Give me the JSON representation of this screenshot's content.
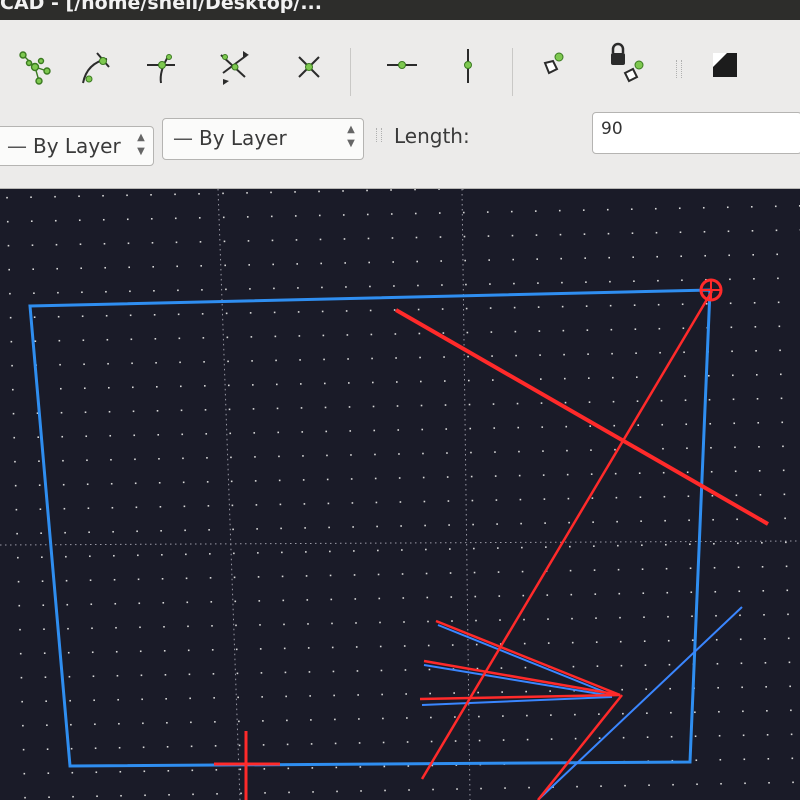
{
  "window": {
    "title": "CAD - [/home/shell/Desktop/..."
  },
  "toolbar": {
    "tools": [
      "snap-free-icon",
      "snap-on-entity-icon",
      "snap-center-icon",
      "snap-intersection-icon",
      "snap-crosshair-icon",
      "restrict-horizontal-icon",
      "restrict-vertical-icon",
      "relative-zero-icon",
      "lock-relative-zero-icon",
      "layer-color-icon"
    ]
  },
  "options": {
    "linetype_value": "By Layer",
    "linewidth_value": "By Layer",
    "length_label": "Length:",
    "length_value": "90"
  },
  "colors": {
    "canvas_background": "#1a1b28",
    "grid_dot": "#d8d8d8",
    "rectangle": "#2f8ef0",
    "construction_line": "#ff2a2a",
    "reference_line": "#3a86ff",
    "toolbar_background": "#ecebea"
  }
}
